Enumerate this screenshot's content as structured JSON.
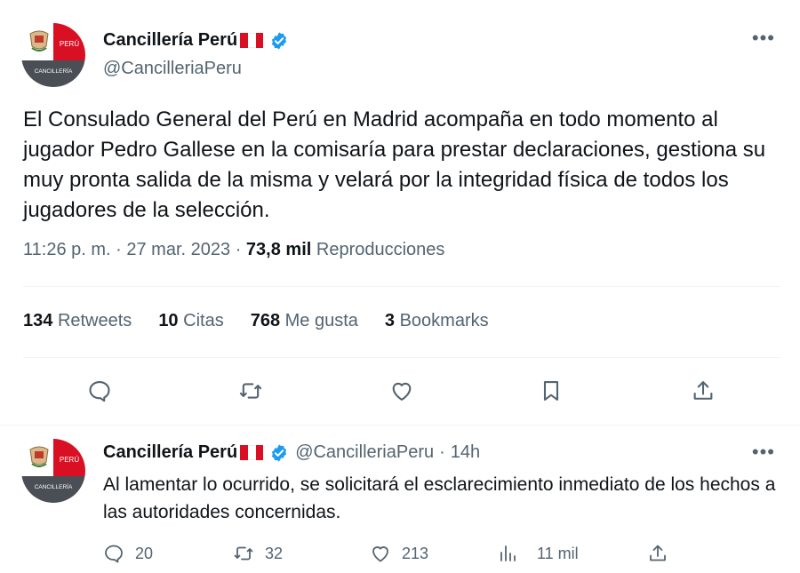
{
  "colors": {
    "verified_blue": "#1d9bf0",
    "flag_red": "#d91023",
    "text_primary": "#0f1419",
    "text_secondary": "#536471"
  },
  "main_tweet": {
    "avatar": {
      "top_label": "PERÚ",
      "bottom_label": "CANCILLERÍA"
    },
    "display_name": "Cancillería Perú",
    "handle": "@CancilleriaPeru",
    "more_icon": "more-horizontal-icon",
    "text": "El Consulado General del Perú en Madrid acompaña en todo momento al jugador Pedro Gallese en la comisaría para prestar declaraciones, gestiona su muy pronta salida de la misma y velará por la integridad física de todos los jugadores de la selección.",
    "time": "11:26 p. m.",
    "separator": "·",
    "date": "27 mar. 2023",
    "views_count": "73,8 mil",
    "views_label": "Reproducciones",
    "stats": [
      {
        "count": "134",
        "label": "Retweets"
      },
      {
        "count": "10",
        "label": "Citas"
      },
      {
        "count": "768",
        "label": "Me gusta"
      },
      {
        "count": "3",
        "label": "Bookmarks"
      }
    ],
    "actions": [
      "reply-icon",
      "retweet-icon",
      "like-icon",
      "bookmark-icon",
      "share-icon"
    ]
  },
  "reply_tweet": {
    "avatar": {
      "top_label": "PERÚ",
      "bottom_label": "CANCILLERÍA"
    },
    "display_name": "Cancillería Perú",
    "handle": "@CancilleriaPeru",
    "separator": "·",
    "time_ago": "14h",
    "text": "Al lamentar lo ocurrido, se solicitará el esclarecimiento inmediato de los hechos a las autoridades concernidas.",
    "reply_count": "20",
    "retweet_count": "32",
    "like_count": "213",
    "views_count": "11 mil"
  }
}
